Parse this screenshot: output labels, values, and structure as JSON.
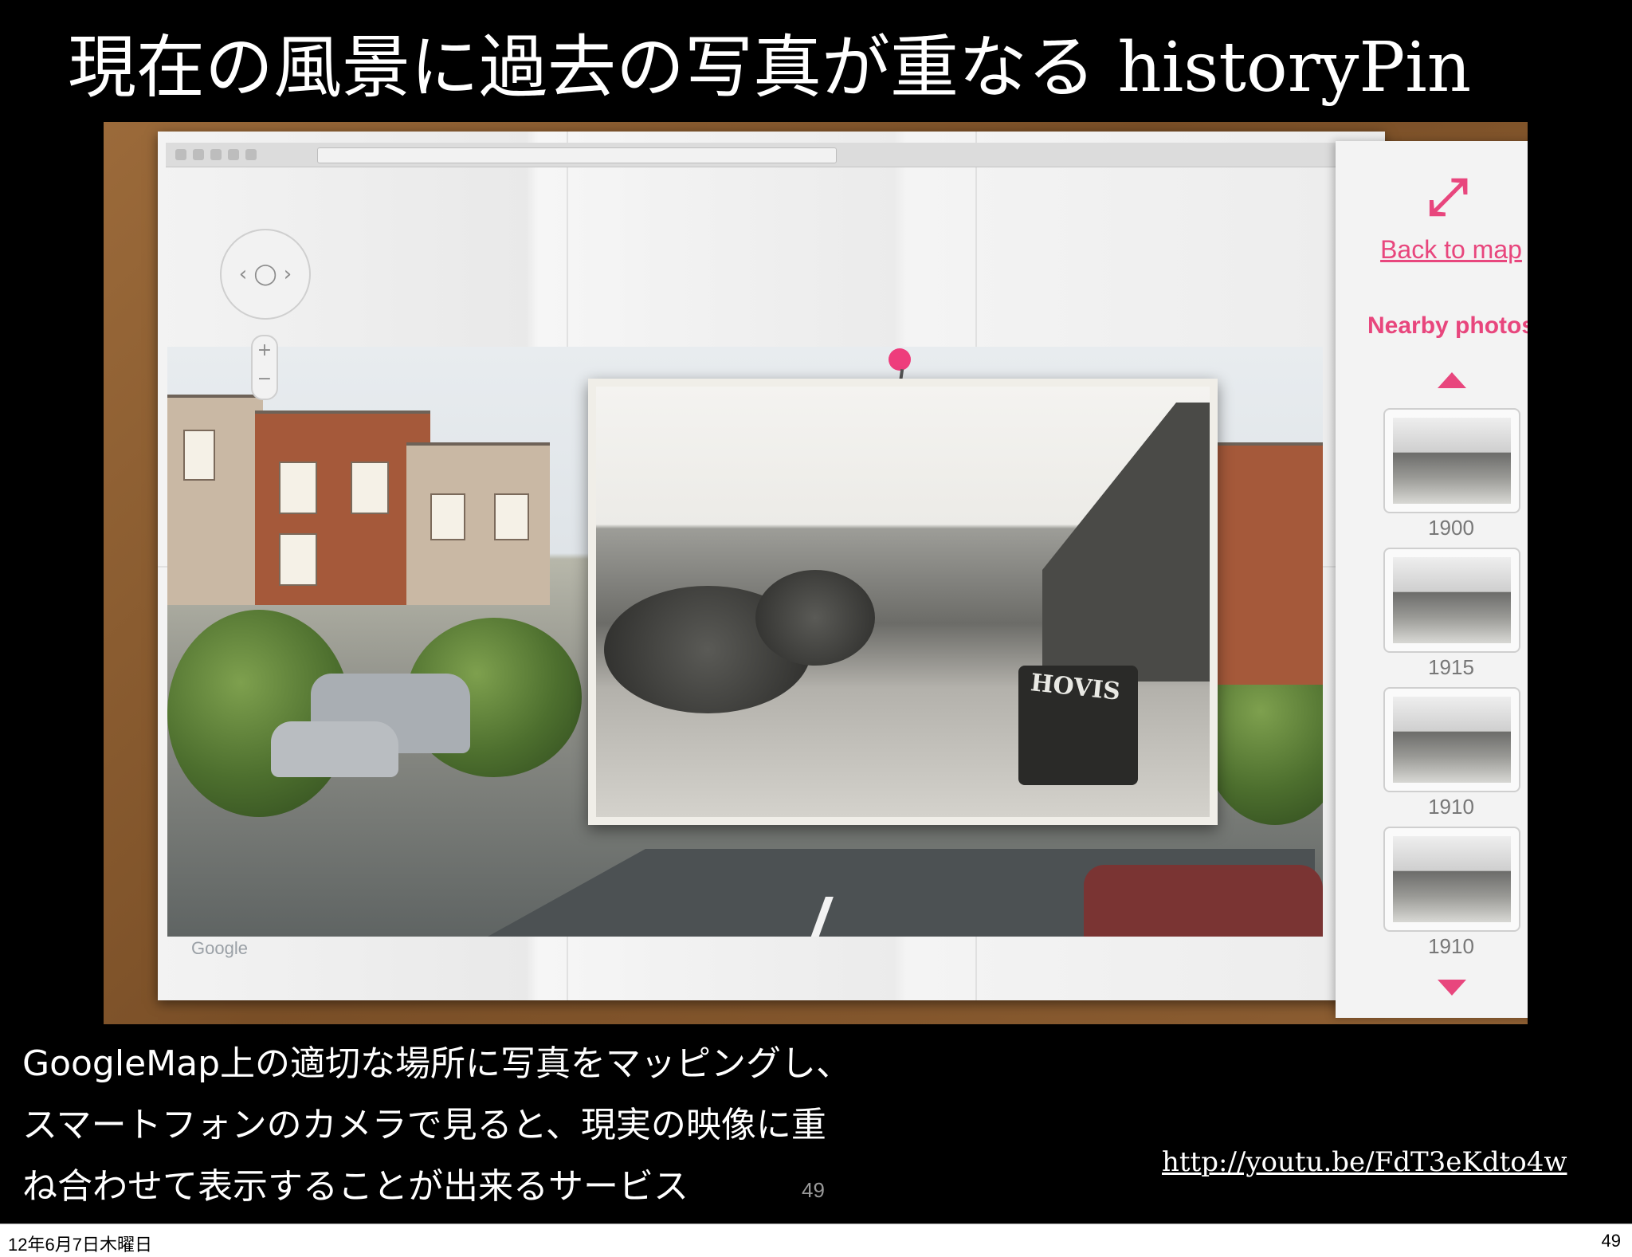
{
  "slide": {
    "title": "現在の風景に過去の写真が重なる historyPin",
    "caption_lines": [
      "GoogleMap上の適切な場所に写真をマッピングし、",
      "スマートフォンのカメラで見ると、現実の映像に重",
      "ね合わせて表示することが出来るサービス"
    ],
    "link": "http://youtu.be/FdT3eKdto4w",
    "slide_number": "49"
  },
  "screenshot": {
    "map_brand": "Google",
    "old_photo_sign": "HOVIS",
    "side_panel": {
      "expand_icon": "expand-arrows-icon",
      "back_to_map": "Back to map",
      "nearby_title": "Nearby photos",
      "thumbnails": [
        {
          "year": "1900"
        },
        {
          "year": "1915"
        },
        {
          "year": "1910"
        },
        {
          "year": "1910"
        }
      ]
    },
    "accent_color": "#e8467d"
  },
  "footer": {
    "date": "12年6月7日木曜日",
    "page": "49"
  }
}
